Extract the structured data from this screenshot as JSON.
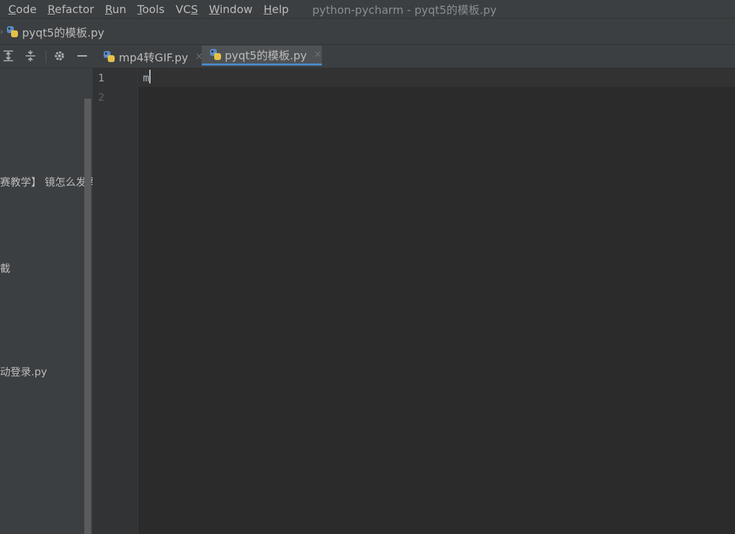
{
  "menubar": {
    "items": [
      {
        "mnemonic": "C",
        "rest": "ode"
      },
      {
        "mnemonic": "R",
        "rest": "efactor"
      },
      {
        "mnemonic": "R",
        "rest": "un"
      },
      {
        "mnemonic": "T",
        "rest": "ools"
      },
      {
        "pre": "VC",
        "mnemonic": "S"
      },
      {
        "mnemonic": "W",
        "rest": "indow"
      },
      {
        "mnemonic": "H",
        "rest": "elp"
      }
    ],
    "window_title": "python-pycharm - pyqt5的模板.py"
  },
  "navbar": {
    "file": "pyqt5的模板.py",
    "icon": "python-file-icon"
  },
  "toolbar": {
    "icons": [
      "expand-all-icon",
      "collapse-all-icon",
      "gear-icon",
      "minimize-icon"
    ]
  },
  "tabs": [
    {
      "label": "mp4转GIF.py",
      "active": false,
      "close": "×"
    },
    {
      "label": "pyqt5的模板.py",
      "active": true,
      "close": "×"
    }
  ],
  "sidebar": {
    "fragments": [
      "赛教学】 镜怎么发挥",
      "截",
      "动登录.py"
    ]
  },
  "editor": {
    "line_numbers": [
      "1",
      "2"
    ],
    "lines": [
      "m",
      ""
    ],
    "colors": {
      "background": "#2b2b2b",
      "current_line": "#323232",
      "text": "#a9b7c6",
      "tab_underline": "#4a88c7"
    }
  }
}
